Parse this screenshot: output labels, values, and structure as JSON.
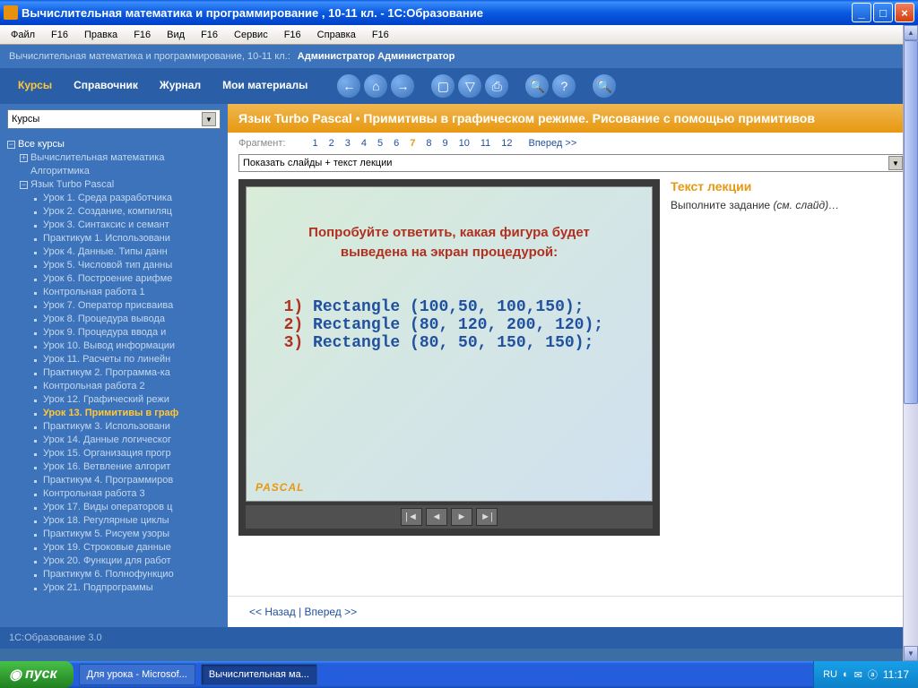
{
  "titlebar": {
    "title": "Вычислительная математика и программирование , 10-11 кл. - 1С:Образование"
  },
  "menubar": [
    "Файл",
    "F16",
    "Правка",
    "F16",
    "Вид",
    "F16",
    "Сервис",
    "F16",
    "Справка",
    "F16"
  ],
  "breadcrumb": {
    "path": "Вычислительная математика и программирование, 10-11 кл.:",
    "user": "Администратор Администратор"
  },
  "tabs": [
    "Курсы",
    "Справочник",
    "Журнал",
    "Мои материалы"
  ],
  "sidebar_select": "Курсы",
  "tree": {
    "root": "Все курсы",
    "l1": [
      "Вычислительная математика",
      "Алгоритмика",
      "Язык Turbo Pascal"
    ],
    "pascal_lessons": [
      "Урок 1. Среда разработчика",
      "Урок 2. Создание, компиляц",
      "Урок 3. Синтаксис и семант",
      "Практикум 1. Использовани",
      "Урок 4. Данные. Типы данн",
      "Урок 5. Числовой тип данны",
      "Урок 6. Построение арифме",
      "Контрольная работа 1",
      "Урок 7. Оператор присваива",
      "Урок 8. Процедура вывода",
      "Урок 9. Процедура ввода и",
      "Урок 10. Вывод информации",
      "Урок 11. Расчеты по линейн",
      "Практикум 2. Программа-ка",
      "Контрольная работа 2",
      "Урок 12. Графический режи",
      "Урок 13. Примитивы в граф",
      "Практикум 3. Использовани",
      "Урок 14. Данные логическог",
      "Урок 15. Организация прогр",
      "Урок 16. Ветвление алгорит",
      "Практикум 4. Программиров",
      "Контрольная работа 3",
      "Урок 17. Виды операторов ц",
      "Урок 18. Регулярные циклы",
      "Практикум 5. Рисуем узоры",
      "Урок 19. Строковые данные",
      "Урок 20. Функции для работ",
      "Практикум 6. Полнофункцио",
      "Урок 21. Подпрограммы"
    ],
    "active_index": 16
  },
  "lesson": {
    "title": "Язык Turbo Pascal • Примитивы в графическом режиме. Рисование с помощью примитивов",
    "frag_label": "Фрагмент:",
    "pages": [
      "1",
      "2",
      "3",
      "4",
      "5",
      "6",
      "7",
      "8",
      "9",
      "10",
      "11",
      "12"
    ],
    "current_page": "7",
    "forward": "Вперед >>",
    "slide_select": "Показать слайды + текст лекции",
    "question_l1": "Попробуйте ответить, какая фигура будет",
    "question_l2": "выведена на экран  процедурой:",
    "code": [
      {
        "n": "1)",
        "t": "Rectangle (100,50, 100,150);"
      },
      {
        "n": "2)",
        "t": "Rectangle (80, 120, 200, 120);"
      },
      {
        "n": "3)",
        "t": "Rectangle (80, 50, 150, 150);"
      }
    ],
    "pascal_tag": "PASCAL",
    "text_heading": "Текст лекции",
    "text_body_a": "Выполните задание ",
    "text_body_b": "(см. слайд)…",
    "back": "<< Назад",
    "fwd": "Вперед >>",
    "sep": " | "
  },
  "statusbar": "1С:Образование 3.0",
  "taskbar": {
    "start": "пуск",
    "items": [
      "Для урока - Microsof...",
      "Вычислительная ма..."
    ],
    "lang": "RU",
    "time": "11:17"
  }
}
